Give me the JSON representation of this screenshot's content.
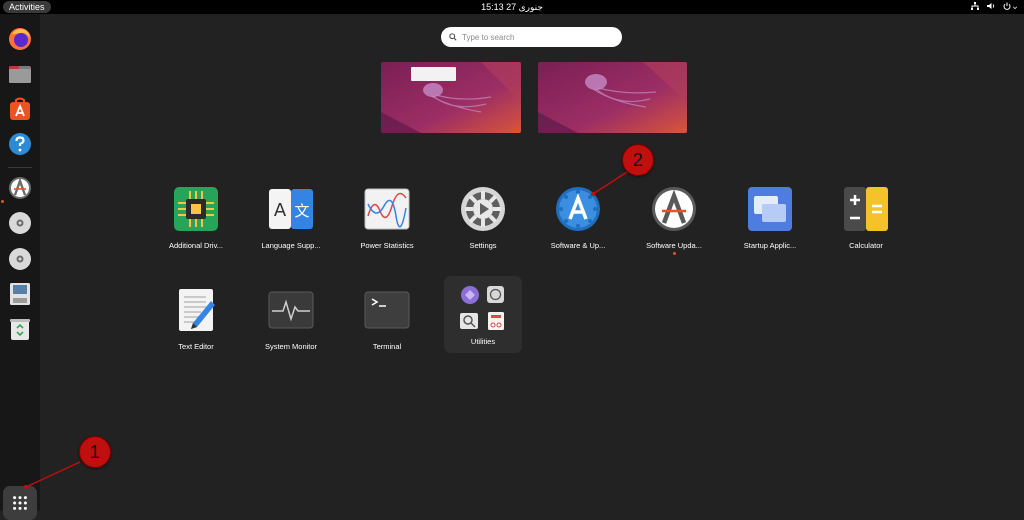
{
  "topbar": {
    "activities_label": "Activities",
    "clock": "15:13  27 جنوری",
    "tray_icons": [
      "network-icon",
      "volume-icon",
      "power-icon"
    ]
  },
  "dock": {
    "items": [
      {
        "name": "firefox-icon"
      },
      {
        "name": "files-icon"
      },
      {
        "name": "app-center-icon"
      },
      {
        "name": "help-icon"
      },
      {
        "name": "software-updater-icon",
        "running": true
      },
      {
        "name": "disc-icon"
      },
      {
        "name": "disc-icon"
      },
      {
        "name": "floppy-icon"
      },
      {
        "name": "trash-icon"
      }
    ],
    "show_apps_icon": "grid-icon"
  },
  "search": {
    "placeholder": "Type to search"
  },
  "workspaces": 2,
  "apps": [
    {
      "label": "Additional Driv...",
      "icon": "chip-icon"
    },
    {
      "label": "Language Supp...",
      "icon": "language-icon"
    },
    {
      "label": "Power Statistics",
      "icon": "power-statistics-icon"
    },
    {
      "label": "Settings",
      "icon": "settings-gear-icon"
    },
    {
      "label": "Software & Up...",
      "icon": "software-sources-icon"
    },
    {
      "label": "Software Upda...",
      "icon": "software-updater-icon",
      "running": true
    },
    {
      "label": "Startup Applic...",
      "icon": "startup-apps-icon"
    },
    {
      "label": "Calculator",
      "icon": "calculator-icon"
    },
    {
      "label": "Text Editor",
      "icon": "text-editor-icon"
    },
    {
      "label": "System Monitor",
      "icon": "system-monitor-icon"
    },
    {
      "label": "Terminal",
      "icon": "terminal-icon"
    },
    {
      "label": "Utilities",
      "icon": "folder-icon"
    }
  ],
  "annotations": [
    "1",
    "2"
  ],
  "colors": {
    "ubuntu_orange": "#e95420",
    "background": "#222222",
    "dock": "#171717",
    "callout_red": "#c00f0f"
  }
}
